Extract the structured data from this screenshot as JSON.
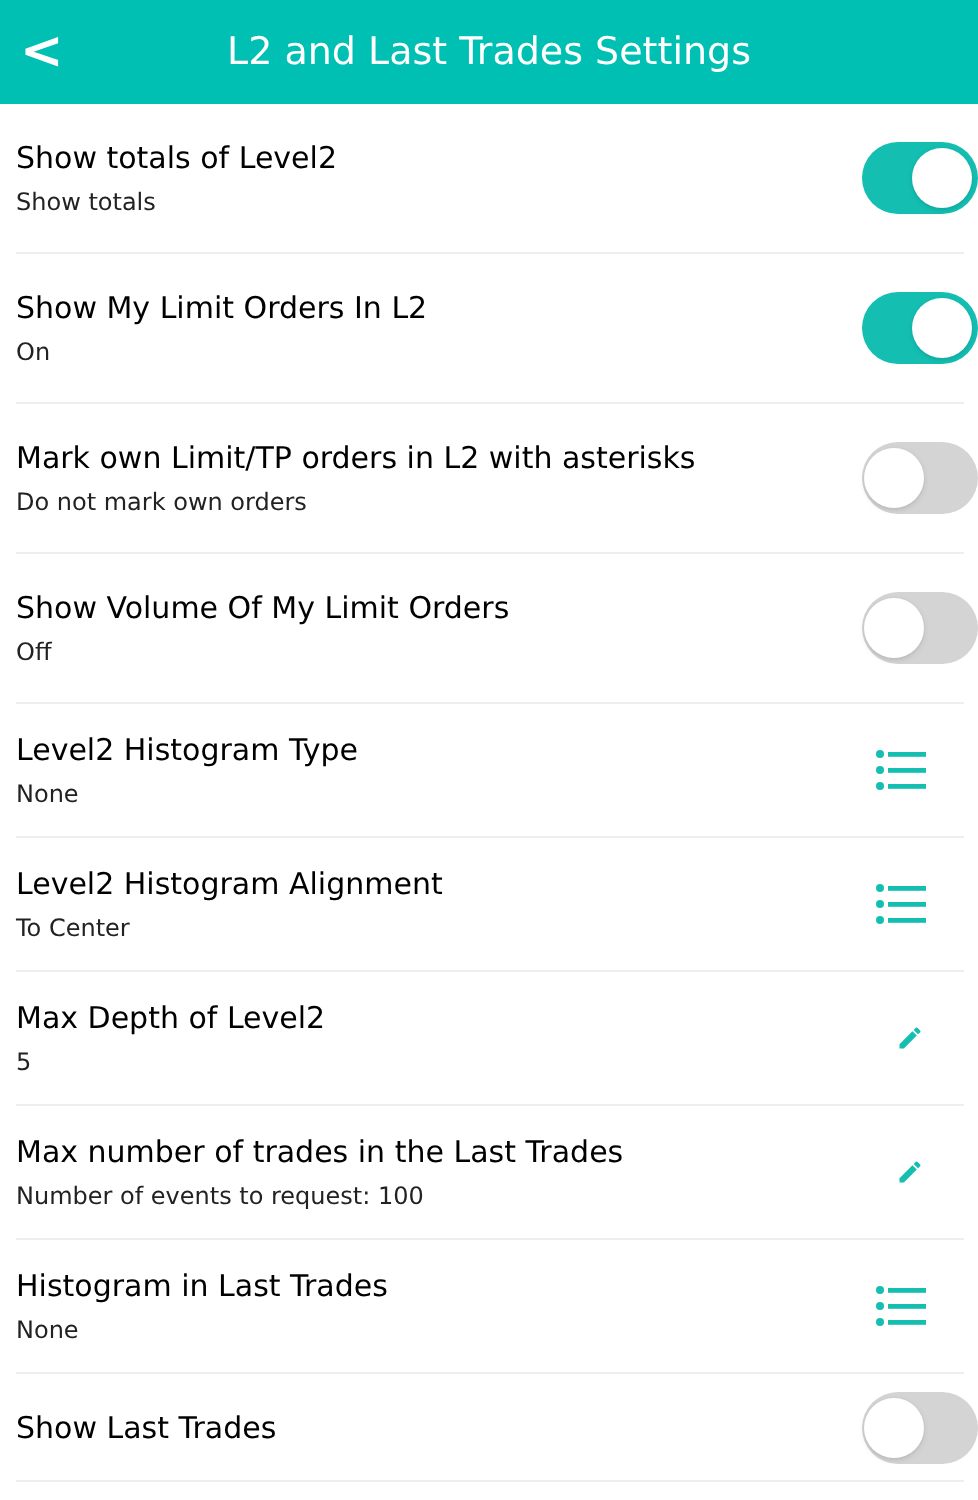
{
  "header": {
    "back": "<",
    "title": "L2 and Last Trades Settings"
  },
  "settings": [
    {
      "kind": "toggle",
      "title": "Show totals of Level2",
      "value": "Show totals",
      "on": true
    },
    {
      "kind": "toggle",
      "title": "Show My Limit Orders In L2",
      "value": "On",
      "on": true
    },
    {
      "kind": "toggle",
      "title": "Mark own Limit/TP orders in L2 with asterisks",
      "value": "Do not mark own orders",
      "on": false
    },
    {
      "kind": "toggle",
      "title": "Show Volume Of My Limit Orders",
      "value": "Off",
      "on": false
    },
    {
      "kind": "list",
      "title": "Level2 Histogram Type",
      "value": "None"
    },
    {
      "kind": "list",
      "title": "Level2 Histogram Alignment",
      "value": "To Center"
    },
    {
      "kind": "edit",
      "title": "Max Depth of Level2",
      "value": "5"
    },
    {
      "kind": "edit",
      "title": "Max number of trades in the Last Trades",
      "value": "Number of events to request: 100"
    },
    {
      "kind": "list",
      "title": "Histogram in Last Trades",
      "value": "None"
    },
    {
      "kind": "toggle",
      "title": "Show Last Trades",
      "on": false
    }
  ]
}
